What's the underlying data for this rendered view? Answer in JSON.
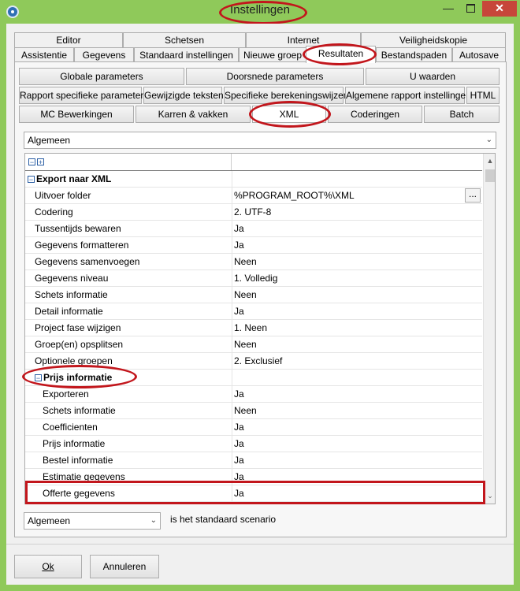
{
  "window": {
    "title": "Instellingen"
  },
  "tabs_row1": [
    "Editor",
    "Schetsen",
    "Internet",
    "Veiligheidskopie"
  ],
  "tabs_row2": [
    "Assistentie",
    "Gegevens",
    "Standaard instellingen",
    "Nieuwe groep",
    "Resultaten",
    "Bestandspaden",
    "Autosave"
  ],
  "active_tab": "Resultaten",
  "buttons_row1": [
    "Globale parameters",
    "Doorsnede parameters",
    "U waarden"
  ],
  "buttons_row2": [
    "Rapport specifieke parameters",
    "Gewijzigde teksten",
    "Specifieke berekeningswijzen",
    "Algemene rapport instellingen",
    "HTML"
  ],
  "buttons_row3": [
    "MC Bewerkingen",
    "Karren & vakken",
    "XML",
    "Coderingen",
    "Batch"
  ],
  "active_button": "XML",
  "scenario_select": {
    "value": "Algemeen"
  },
  "grid": {
    "header_icons": [
      "collapse-all-icon",
      "expand-all-icon"
    ],
    "rows": [
      {
        "kind": "category",
        "name": "Export naar XML",
        "value": ""
      },
      {
        "kind": "property",
        "name": "Uitvoer folder",
        "value": "%PROGRAM_ROOT%\\XML",
        "has_button": true,
        "button_label": "..."
      },
      {
        "kind": "property",
        "name": "Codering",
        "value": "2. UTF-8"
      },
      {
        "kind": "property",
        "name": "Tussentijds bewaren",
        "value": "Ja"
      },
      {
        "kind": "property",
        "name": "Gegevens formatteren",
        "value": "Ja"
      },
      {
        "kind": "property",
        "name": "Gegevens samenvoegen",
        "value": "Neen"
      },
      {
        "kind": "property",
        "name": "Gegevens niveau",
        "value": "1. Volledig"
      },
      {
        "kind": "property",
        "name": "Schets informatie",
        "value": "Neen"
      },
      {
        "kind": "property",
        "name": "Detail informatie",
        "value": "Ja"
      },
      {
        "kind": "property",
        "name": "Project fase wijzigen",
        "value": "1. Neen"
      },
      {
        "kind": "property",
        "name": "Groep(en) opsplitsen",
        "value": "Neen"
      },
      {
        "kind": "property",
        "name": "Optionele groepen",
        "value": "2. Exclusief"
      },
      {
        "kind": "subcategory",
        "name": "Prijs informatie",
        "value": ""
      },
      {
        "kind": "subproperty",
        "name": "Exporteren",
        "value": "Ja"
      },
      {
        "kind": "subproperty",
        "name": "Schets informatie",
        "value": "Neen"
      },
      {
        "kind": "subproperty",
        "name": "Coefficienten",
        "value": "Ja"
      },
      {
        "kind": "subproperty",
        "name": "Prijs informatie",
        "value": "Ja"
      },
      {
        "kind": "subproperty",
        "name": "Bestel informatie",
        "value": "Ja"
      },
      {
        "kind": "subproperty",
        "name": "Estimatie gegevens",
        "value": "Ja"
      },
      {
        "kind": "subproperty",
        "name": "Offerte gegevens",
        "value": "Ja"
      }
    ]
  },
  "footer": {
    "scenario_value": "Algemeen",
    "scenario_text": "is het standaard scenario",
    "ok_label": "Ok",
    "cancel_label": "Annuleren"
  },
  "colors": {
    "window_border": "#8fc95a",
    "highlight_red": "#c2161c",
    "close_button": "#c7463a"
  }
}
